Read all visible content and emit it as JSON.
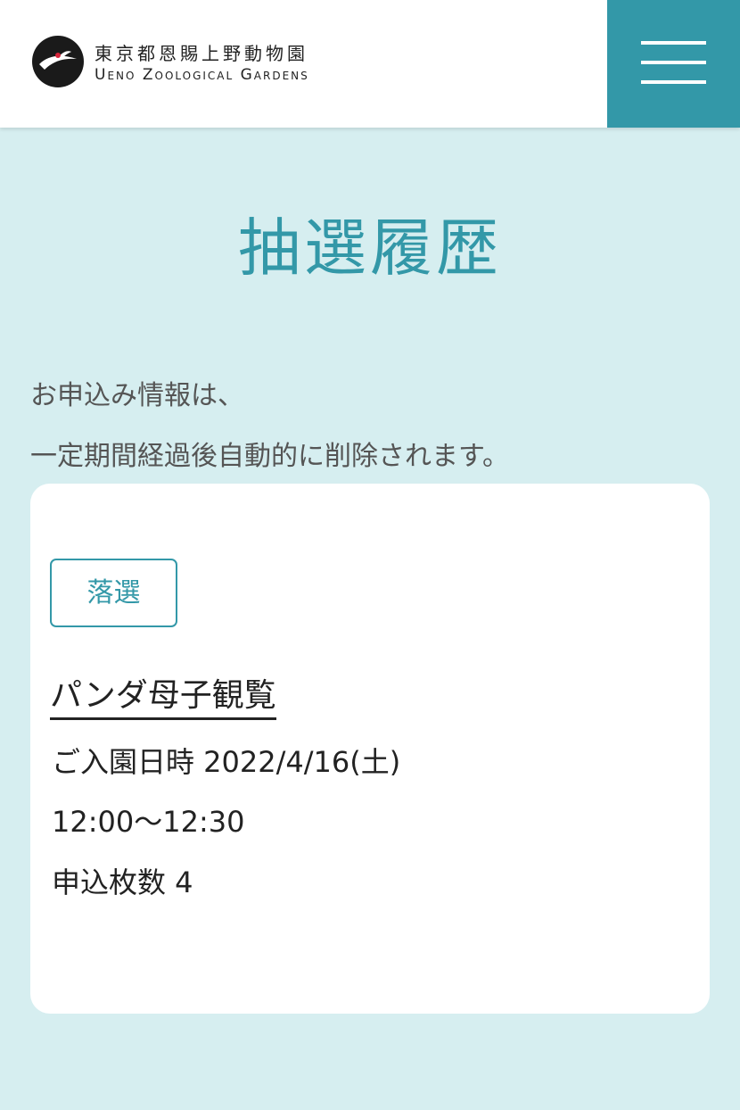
{
  "header": {
    "logo_text_jp": "東京都恩賜上野動物園",
    "logo_text_en": "Ueno Zoological Gardens",
    "logo_icon": "crane-logo-icon",
    "menu_icon": "hamburger-menu-icon"
  },
  "page": {
    "title": "抽選履歴",
    "notice_line1": "お申込み情報は、",
    "notice_line2": "一定期間経過後自動的に削除されます。"
  },
  "card": {
    "status": "落選",
    "event_title": "パンダ母子観覧",
    "visit_datetime": "ご入園日時 2022/4/16(土)",
    "time_slot": "12:00〜12:30",
    "ticket_count": "申込枚数 4"
  },
  "colors": {
    "accent": "#3398a8",
    "background": "#d6eef0",
    "card": "#ffffff"
  }
}
